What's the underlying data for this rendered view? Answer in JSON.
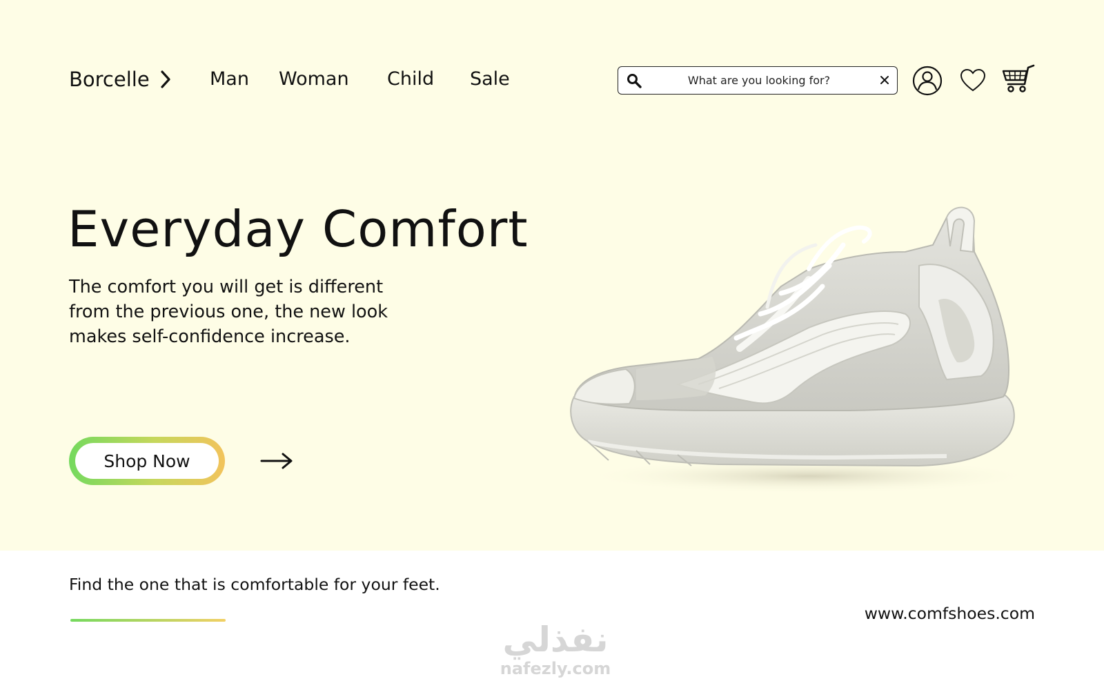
{
  "nav": {
    "brand": "Borcelle",
    "items": [
      "Man",
      "Woman",
      "Child",
      "Sale"
    ]
  },
  "search": {
    "placeholder": "What are you looking for?"
  },
  "hero": {
    "title": "Everyday Comfort",
    "description": "The comfort you will get is different from the previous one, the new look makes self-confidence increase.",
    "cta_label": "Shop Now"
  },
  "footer": {
    "tagline": "Find the one that is comfortable for your feet.",
    "website": "www.comfshoes.com"
  },
  "watermark": {
    "logo": "نفذلي",
    "url": "nafezly.com"
  },
  "icons": {
    "search": "search-icon",
    "clear": "close-icon",
    "account": "user-icon",
    "wishlist": "heart-icon",
    "cart": "cart-icon",
    "cta_arrow": "arrow-right-icon",
    "brand_chevron": "chevron-right-icon"
  },
  "colors": {
    "hero_background": "#fefde6",
    "page_background": "#ffffff",
    "gradient_start": "#74d95e",
    "gradient_end": "#f2c35c",
    "text": "#111111"
  }
}
